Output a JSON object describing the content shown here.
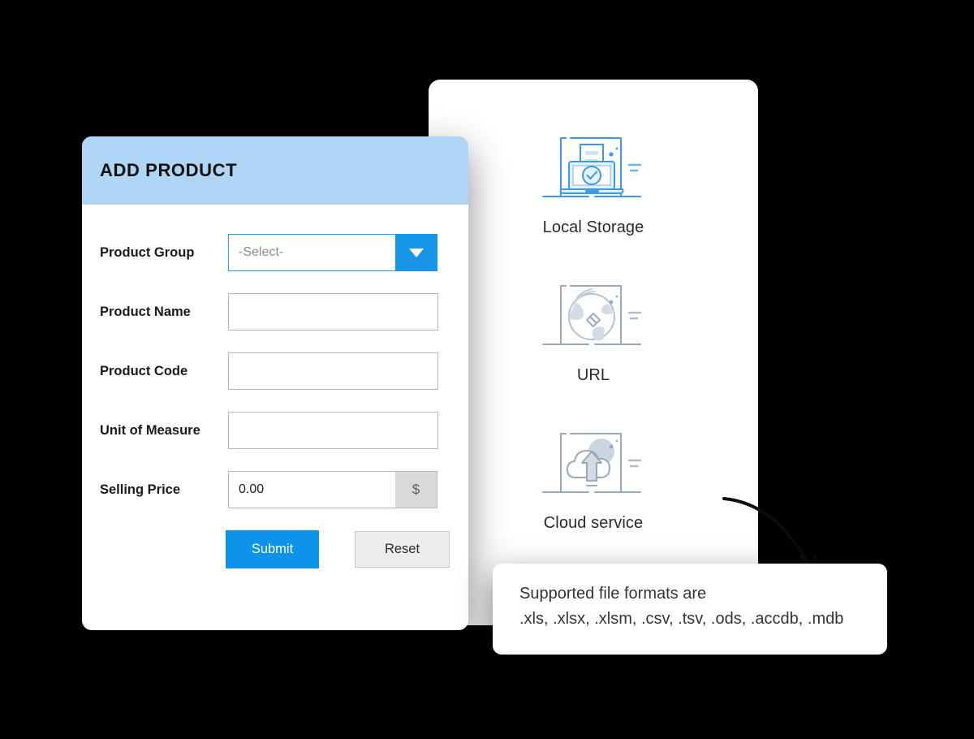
{
  "background_color": "#000000",
  "form": {
    "title": "ADD PRODUCT",
    "header_color": "#afd6f5",
    "accent_color": "#0d93e9",
    "fields": [
      {
        "label": "Product Group",
        "type": "select",
        "value": "-Select-",
        "placeholder": "-Select-",
        "icon": "chevron-down-icon"
      },
      {
        "label": "Product Name",
        "type": "text",
        "value": "",
        "placeholder": ""
      },
      {
        "label": "Product Code",
        "type": "text",
        "value": "",
        "placeholder": ""
      },
      {
        "label": "Unit of Measure",
        "type": "text",
        "value": "",
        "placeholder": ""
      },
      {
        "label": "Selling Price",
        "type": "currency",
        "value": "0.00",
        "placeholder": "0.00",
        "suffix": "$"
      }
    ],
    "buttons": {
      "submit_label": "Submit",
      "reset_label": "Reset"
    }
  },
  "sources": {
    "items": [
      {
        "label": "Local Storage",
        "icon": "laptop-upload-icon",
        "state": "active",
        "color": "#3d9ae8"
      },
      {
        "label": "URL",
        "icon": "globe-link-icon",
        "state": "inactive",
        "color": "#9aa9bb"
      },
      {
        "label": "Cloud service",
        "icon": "cloud-upload-icon",
        "state": "inactive",
        "color": "#9aa9bb"
      }
    ]
  },
  "callout": {
    "line1": "Supported file formats are",
    "line2": ".xls, .xlsx, .xlsm, .csv, .tsv, .ods, .accdb, .mdb",
    "pointer_icon": "curved-arrow-icon"
  }
}
